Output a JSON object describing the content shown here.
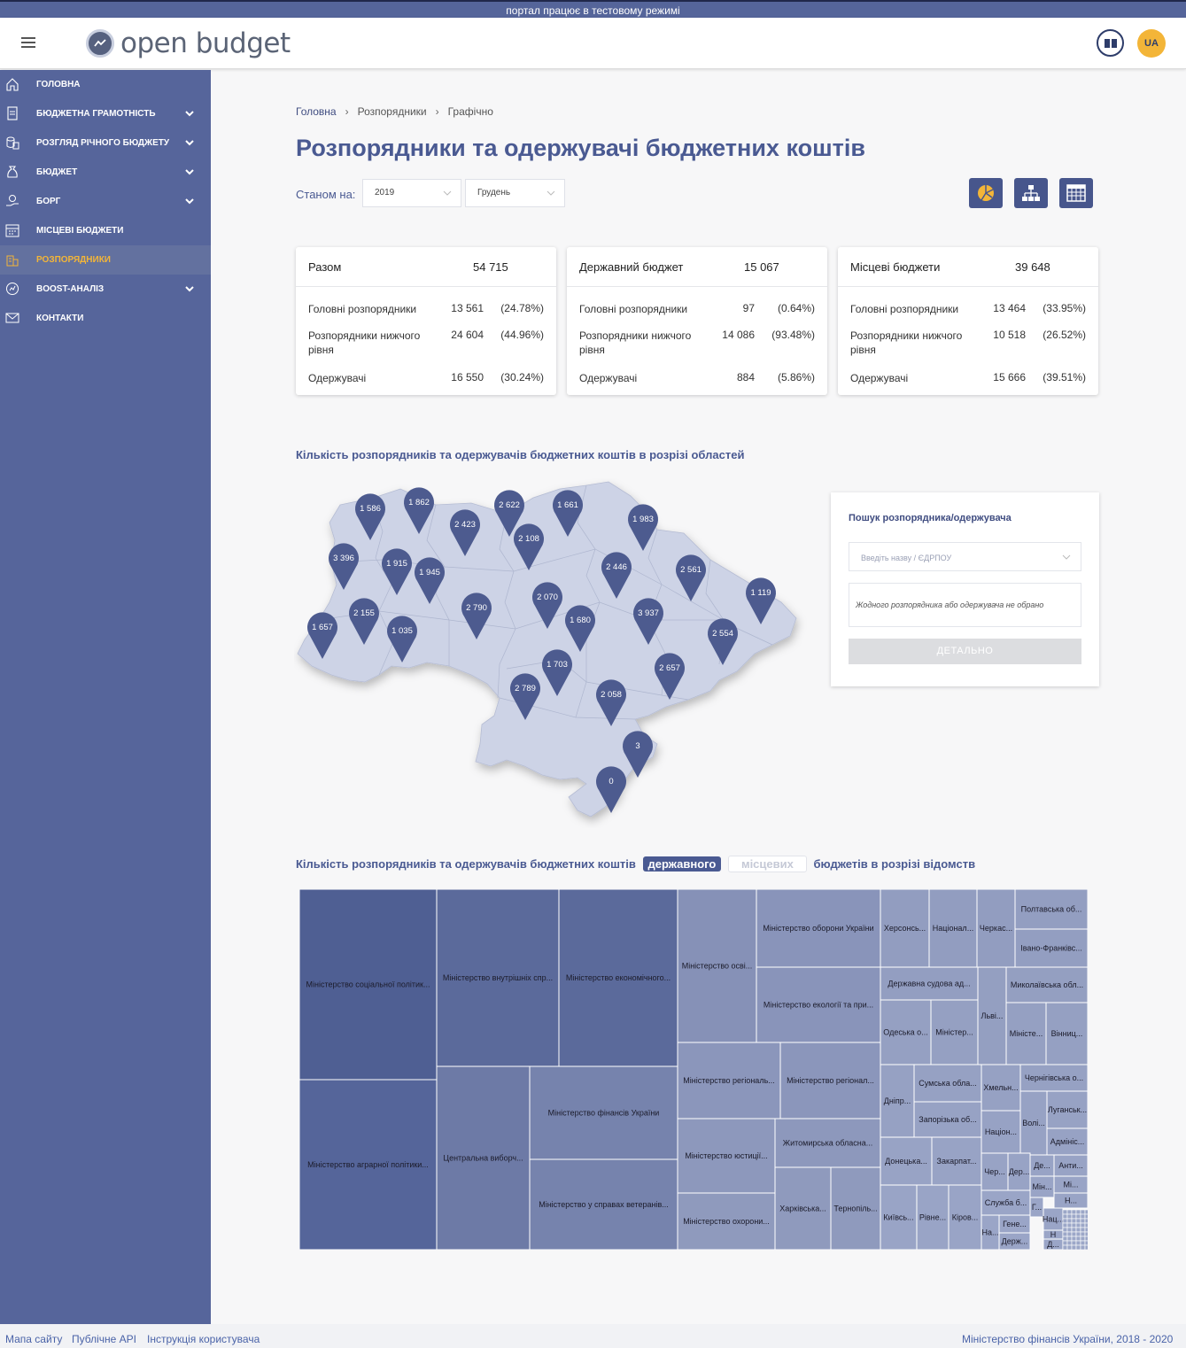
{
  "banner": "портал працює в тестовому режимі",
  "header": {
    "logo_text": "open budget",
    "lang": "UA"
  },
  "sidebar": [
    {
      "label": "ГОЛОВНА",
      "icon": "home-icon",
      "chevron": false
    },
    {
      "label": "БЮДЖЕТНА ГРАМОТНІСТЬ",
      "icon": "document-icon",
      "chevron": true
    },
    {
      "label": "РОЗГЛЯД РІЧНОГО БЮДЖЕТУ",
      "icon": "coins-icon",
      "chevron": true
    },
    {
      "label": "БЮДЖЕТ",
      "icon": "money-bag-icon",
      "chevron": true
    },
    {
      "label": "БОРГ",
      "icon": "hand-coin-icon",
      "chevron": true
    },
    {
      "label": "МІСЦЕВІ БЮДЖЕТИ",
      "icon": "calendar-icon",
      "chevron": false
    },
    {
      "label": "РОЗПОРЯДНИКИ",
      "icon": "building-icon",
      "chevron": false,
      "active": true
    },
    {
      "label": "BOOST-АНАЛІЗ",
      "icon": "chart-circle-icon",
      "chevron": true
    },
    {
      "label": "КОНТАКТИ",
      "icon": "envelope-icon",
      "chevron": false
    }
  ],
  "breadcrumb": {
    "home": "Головна",
    "second": "Розпорядники",
    "current": "Графічно"
  },
  "title": "Розпорядники та одержувачі бюджетних коштів",
  "filter": {
    "label": "Станом на:",
    "year": "2019",
    "month": "Грудень"
  },
  "cards": [
    {
      "title": "Разом",
      "total": "54 715",
      "rows": [
        {
          "label": "Головні розпорядники",
          "value": "13 561",
          "pct": "(24.78%)"
        },
        {
          "label": "Розпорядники нижчого рівня",
          "value": "24 604",
          "pct": "(44.96%)"
        },
        {
          "label": "Одержувачі",
          "value": "16 550",
          "pct": "(30.24%)"
        }
      ]
    },
    {
      "title": "Державний бюджет",
      "total": "15 067",
      "rows": [
        {
          "label": "Головні розпорядники",
          "value": "97",
          "pct": "(0.64%)"
        },
        {
          "label": "Розпорядники нижчого рівня",
          "value": "14 086",
          "pct": "(93.48%)"
        },
        {
          "label": "Одержувачі",
          "value": "884",
          "pct": "(5.86%)"
        }
      ]
    },
    {
      "title": "Місцеві бюджети",
      "total": "39 648",
      "rows": [
        {
          "label": "Головні розпорядники",
          "value": "13 464",
          "pct": "(33.95%)"
        },
        {
          "label": "Розпорядники нижчого рівня",
          "value": "10 518",
          "pct": "(26.52%)"
        },
        {
          "label": "Одержувачі",
          "value": "15 666",
          "pct": "(39.51%)"
        }
      ]
    }
  ],
  "map_section": {
    "title": "Кількість розпорядників та одержувачів бюджетних коштів в розрізі областей"
  },
  "map_pins": [
    "1 586",
    "1 862",
    "2 423",
    "2 622",
    "1 661",
    "1 983",
    "2 108",
    "3 396",
    "1 915",
    "1 945",
    "2 446",
    "2 561",
    "2 070",
    "1 119",
    "2 155",
    "2 790",
    "1 680",
    "3 937",
    "1 657",
    "1 035",
    "2 554",
    "1 703",
    "2 657",
    "2 789",
    "2 058",
    "3",
    "0"
  ],
  "search": {
    "title": "Пошук розпорядника/одержувача",
    "placeholder": "Введіть назву / ЄДРПОУ",
    "note": "Жодного розпорядника або одержувача не обрано",
    "button": "ДЕТАЛЬНО"
  },
  "treemap_section": {
    "title_start": "Кількість розпорядників та одержувачів бюджетних коштів",
    "toggle_on": "державного",
    "toggle_off": "місцевих",
    "title_end": "бюджетів в розрізі відомств"
  },
  "treemap_labels": [
    "Міністерство соціальної політик...",
    "Міністерство аграрної політики...",
    "Міністерство внутрішніх спр...",
    "Міністерство економічного...",
    "Центральна виборч...",
    "Міністерство фінансів України",
    "Міністерство у справах ветеранів...",
    "Міністерство осві...",
    "Міністерство оборони України",
    "Міністерство екології та при...",
    "Міністерство регіональ...",
    "Міністерство регіонал...",
    "Міністерство юстиції...",
    "Житомирська обласна...",
    "Міністерство охорони...",
    "Харківська...",
    "Тернопіль...",
    "Херсонсь...",
    "Націонал...",
    "Черкас...",
    "Полтавська об...",
    "Івано-Франківс...",
    "Державна судова ад...",
    "Львi...",
    "Миколаївська обл...",
    "Одеська о...",
    "Міністер...",
    "Мiністе...",
    "Вінниц...",
    "Дніпр...",
    "Сумська обла...",
    "Хмельн...",
    "Чернігівська о...",
    "Запорізька об...",
    "Волі...",
    "Луганськ...",
    "Націон...",
    "Адмініс...",
    "Донецька...",
    "Закарпат...",
    "Де...",
    "Анти...",
    "Чер...",
    "Дер...",
    "Мін...",
    "Мі...",
    "Н...",
    "Київсь...",
    "Рівне...",
    "Кіров...",
    "Служба б...",
    "Г...",
    "Нац...",
    "Гене...",
    "На...",
    "Н",
    "Держ...",
    "Д..."
  ],
  "footer": {
    "sitemap": "Мапа сайту",
    "api": "Публічне API",
    "manual": "Інструкція користувача",
    "copyright": "Міністерство фінансів України, 2018 - 2020"
  },
  "colors": {
    "accent": "#4a5a92",
    "sidebar": "#56659b",
    "active": "#f3b538",
    "map": "#cdd3e6",
    "pin": "#4d5b8f"
  }
}
